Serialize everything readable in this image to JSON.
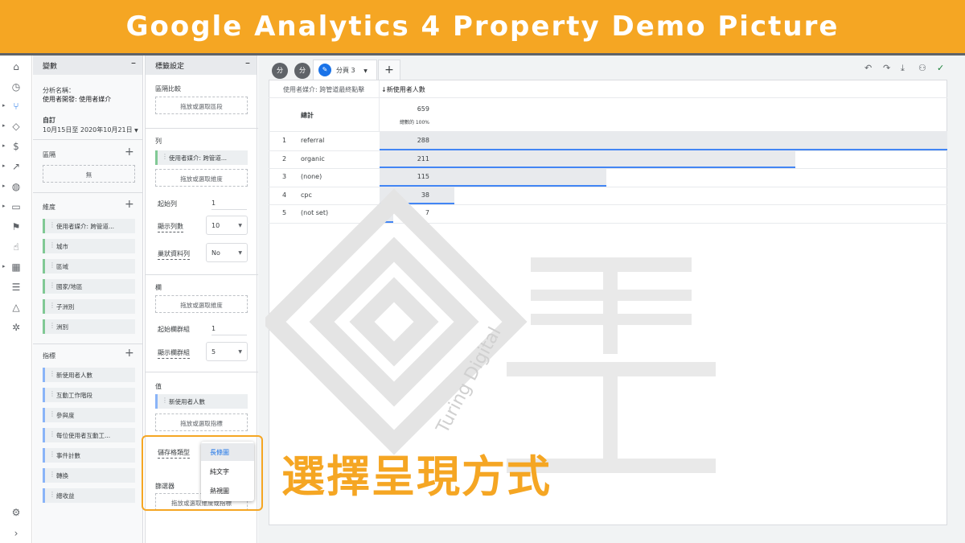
{
  "banner": {
    "title": "Google Analytics 4 Property Demo Picture"
  },
  "rail": {
    "icons": [
      "home-icon",
      "clock-icon",
      "explore-icon",
      "tag-icon",
      "dollar-icon",
      "wand-icon",
      "globe-icon",
      "devices-icon",
      "flag-icon",
      "touch-icon",
      "report-icon",
      "audience-icon",
      "shapes-icon",
      "bug-icon"
    ],
    "settings_icon": "gear-icon",
    "expand_icon": "chevron-right-icon"
  },
  "variables": {
    "header": "變數",
    "analysis_name_label": "分析名稱：",
    "analysis_name": "使用者開發: 使用者媒介",
    "date_label": "自訂",
    "date_range": "10月15日至 2020年10月21日",
    "segments_label": "區隔",
    "segments_empty": "無",
    "dimensions_label": "維度",
    "dimensions": [
      "使用者媒介: 跨管道...",
      "城市",
      "區域",
      "國家/地區",
      "子洲別",
      "洲別"
    ],
    "metrics_label": "指標",
    "metrics": [
      "新使用者人數",
      "互動工作階段",
      "參與度",
      "每位使用者互動工...",
      "事件計數",
      "轉換",
      "總收益"
    ]
  },
  "tab_settings": {
    "header": "標籤設定",
    "segment_compare_label": "區隔比較",
    "segment_drop": "拖放或選取區段",
    "rows_label": "列",
    "rows_chip": "使用者媒介: 跨管道...",
    "rows_drop": "拖放或選取維度",
    "start_row_label": "起始列",
    "start_row_value": "1",
    "show_rows_label": "顯示列數",
    "show_rows_value": "10",
    "nested_rows_label": "巢狀資料列",
    "nested_rows_value": "No",
    "columns_label": "欄",
    "columns_drop": "拖放或選取維度",
    "start_col_group_label": "起始欄群組",
    "start_col_group_value": "1",
    "show_col_groups_label": "顯示欄群組",
    "show_col_groups_value": "5",
    "values_label": "值",
    "values_chip": "新使用者人數",
    "values_drop": "拖放或選取指標",
    "cell_type_label": "儲存格類型",
    "filters_label": "篩選器",
    "filters_drop": "拖放或選取維度或指標",
    "cell_type_options": [
      "長條圖",
      "純文字",
      "熱視圖"
    ],
    "cell_type_selected": "長條圖"
  },
  "report": {
    "tab_badges": [
      "分",
      "分"
    ],
    "active_tab": "分頁 3",
    "add_tab": "+",
    "toolbar_icons": [
      "undo-icon",
      "redo-icon",
      "download-icon",
      "share-icon",
      "check-icon"
    ],
    "dim_header": "使用者媒介: 跨管道最終點擊",
    "metric_header": "↓新使用者人數",
    "total_label": "總計",
    "total_value": "659",
    "total_pct": "總數的 100%",
    "rows": [
      {
        "rank": "1",
        "name": "referral",
        "value": "288"
      },
      {
        "rank": "2",
        "name": "organic",
        "value": "211"
      },
      {
        "rank": "3",
        "name": "(none)",
        "value": "115"
      },
      {
        "rank": "4",
        "name": "cpc",
        "value": "38"
      },
      {
        "rank": "5",
        "name": "(not set)",
        "value": "7"
      }
    ]
  },
  "callout": {
    "text": "選擇呈現方式"
  },
  "watermark": {
    "text": "Turing Digital"
  },
  "colors": {
    "accent": "#f5a623",
    "bar": "#e8eaed",
    "bar_line": "#4285f4"
  }
}
